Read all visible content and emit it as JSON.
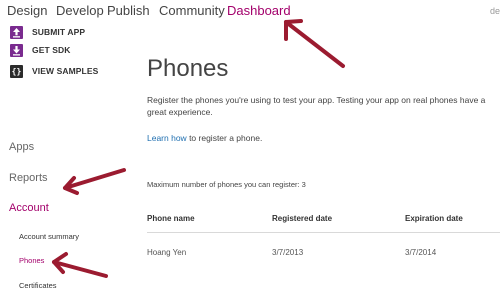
{
  "topnav": {
    "items": [
      "Design",
      "Develop",
      "Publish",
      "Community",
      "Dashboard"
    ],
    "active": "Dashboard",
    "user_fragment": "de"
  },
  "actions": [
    {
      "label": "SUBMIT APP",
      "icon": "upload-icon"
    },
    {
      "label": "GET SDK",
      "icon": "download-icon"
    },
    {
      "label": "VIEW SAMPLES",
      "icon": "braces-icon"
    }
  ],
  "sidenav": {
    "apps": "Apps",
    "reports": "Reports",
    "account": "Account",
    "sub": [
      "Account summary",
      "Phones",
      "Certificates"
    ]
  },
  "main": {
    "title": "Phones",
    "description": "Register the phones you're using to test your app. Testing your app on real phones have a great experience.",
    "learn_link": "Learn how",
    "learn_rest": " to register a phone.",
    "max_text": "Maximum number of phones you can register: 3",
    "table": {
      "headers": [
        "Phone name",
        "Registered date",
        "Expiration date"
      ],
      "rows": [
        [
          "Hoang Yen",
          "3/7/2013",
          "3/7/2014"
        ]
      ]
    }
  },
  "colors": {
    "accent": "#a3006b",
    "arrow": "#9b1b30",
    "link": "#1f6fb0",
    "icon_purple": "#7a2b8f"
  }
}
